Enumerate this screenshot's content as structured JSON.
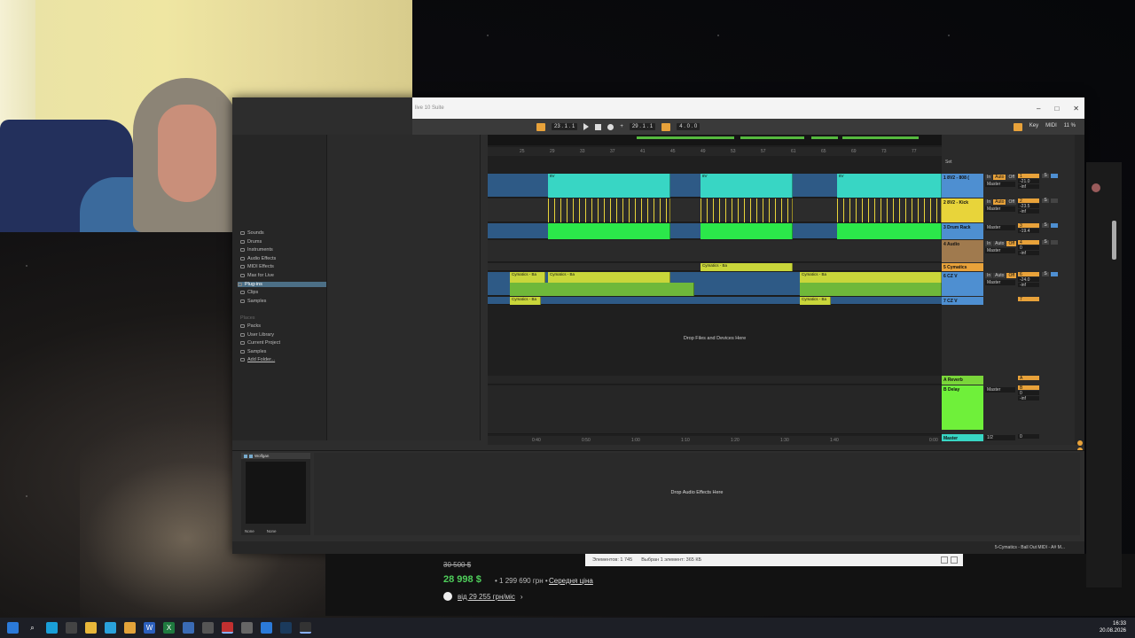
{
  "window": {
    "title": "live 10 Suite"
  },
  "transport": {
    "tempo": "23 . 1 . 1",
    "position": "29 . 1 . 1",
    "loop_length": "4 . 0 . 0",
    "key_label": "Key",
    "midi_label": "MIDI",
    "cpu": "11 %"
  },
  "browser": {
    "categories": [
      {
        "label": "Sounds"
      },
      {
        "label": "Drums"
      },
      {
        "label": "Instruments"
      },
      {
        "label": "Audio Effects"
      },
      {
        "label": "MIDI Effects"
      },
      {
        "label": "Max for Live"
      },
      {
        "label": "Plug-ins"
      },
      {
        "label": "Clips"
      },
      {
        "label": "Samples"
      }
    ],
    "places_header": "Places",
    "places": [
      {
        "label": "Packs"
      },
      {
        "label": "User Library"
      },
      {
        "label": "Current Project"
      },
      {
        "label": "Samples"
      },
      {
        "label": "Add Folder..."
      }
    ]
  },
  "ruler": {
    "bars": [
      "25",
      "29",
      "33",
      "37",
      "41",
      "45",
      "49",
      "53",
      "57",
      "61",
      "65",
      "69",
      "73",
      "77"
    ],
    "times": [
      "0:40",
      "0:50",
      "1:00",
      "1:10",
      "1:20",
      "1:30",
      "1:40",
      "0:00"
    ]
  },
  "clip_names": {
    "drums_short": "8V",
    "cymatics": "Cymatics - Ba"
  },
  "arrangement": {
    "drop_text": "Drop Files and Devices Here"
  },
  "mixer": {
    "set_label": "Set",
    "tracks": [
      {
        "name": "1 8V2 - 808 (",
        "color": "#4e8fd1",
        "in": "In",
        "auto": "Auto",
        "off": "Off",
        "out": "Master",
        "vol": "-21.0",
        "pan": "C",
        "peak": "-inf",
        "num": "1"
      },
      {
        "name": "2 8V2 - Kick",
        "color": "#e8d43a",
        "in": "In",
        "auto": "Auto",
        "off": "Off",
        "out": "Master",
        "vol": "-23.5",
        "pan": "C",
        "peak": "-inf",
        "num": "2"
      },
      {
        "name": "3 Drum Rack",
        "color": "#4e8fd1",
        "in": "",
        "auto": "",
        "off": "",
        "out": "Master",
        "vol": "-19.4",
        "pan": "C",
        "peak": "-inf",
        "num": "3"
      },
      {
        "name": "4 Audio",
        "color": "#a07a4e",
        "in": "In",
        "auto": "Auto",
        "off": "Off",
        "out": "Master",
        "vol": "0",
        "pan": "C",
        "peak": "-inf",
        "num": "4"
      },
      {
        "name": "5 Cymatics",
        "color": "#e8a23a",
        "in": "",
        "auto": "",
        "off": "",
        "out": "",
        "vol": "",
        "pan": "",
        "peak": "",
        "num": "5"
      },
      {
        "name": "6 CZ V",
        "color": "#4e8fd1",
        "in": "In",
        "auto": "Auto",
        "off": "Off",
        "out": "Master",
        "vol": "-24.0",
        "pan": "C",
        "peak": "-inf",
        "num": "6"
      },
      {
        "name": "7 CZ V",
        "color": "#4e8fd1",
        "in": "",
        "auto": "",
        "off": "",
        "out": "",
        "vol": "",
        "pan": "",
        "peak": "",
        "num": "7"
      }
    ],
    "returns": [
      {
        "name": "A Reverb",
        "color": "#7ad63a",
        "num": "A"
      },
      {
        "name": "B Delay",
        "color": "#6ff03a",
        "out": "Master",
        "vol": "0",
        "pan": "C",
        "peak": "-inf",
        "num": "B"
      }
    ],
    "master": {
      "name": "Master",
      "out": "1/2",
      "vol": "0",
      "pan": "0"
    }
  },
  "detail": {
    "device_name": "Wolfgan",
    "drop_fx": "Drop Audio Effects Here",
    "chain_left": "None",
    "chain_right": "None",
    "status_clip": "5-Cymatics - Ball Out MIDI - A# M..."
  },
  "explorer": {
    "items": "Элементов: 1 745",
    "selected": "Выбран 1 элемент: 365 КБ"
  },
  "shop": {
    "old_price": "30 500 $",
    "new_price": "28 998 $",
    "uah_price": "• 1 299 690 грн •",
    "mid_price": "Середня ціна",
    "credit": "від 29 255 грн/міс",
    "arrow": "›"
  },
  "taskbar": {
    "time": "16:33",
    "date": "20.08.2026"
  },
  "colors": {
    "accent": "#e8a23a",
    "cyan_clip": "#38d6c4",
    "green_clip": "#6fd63a",
    "blue_track": "#4e8fd1",
    "yellow_clip": "#c9d63a"
  }
}
